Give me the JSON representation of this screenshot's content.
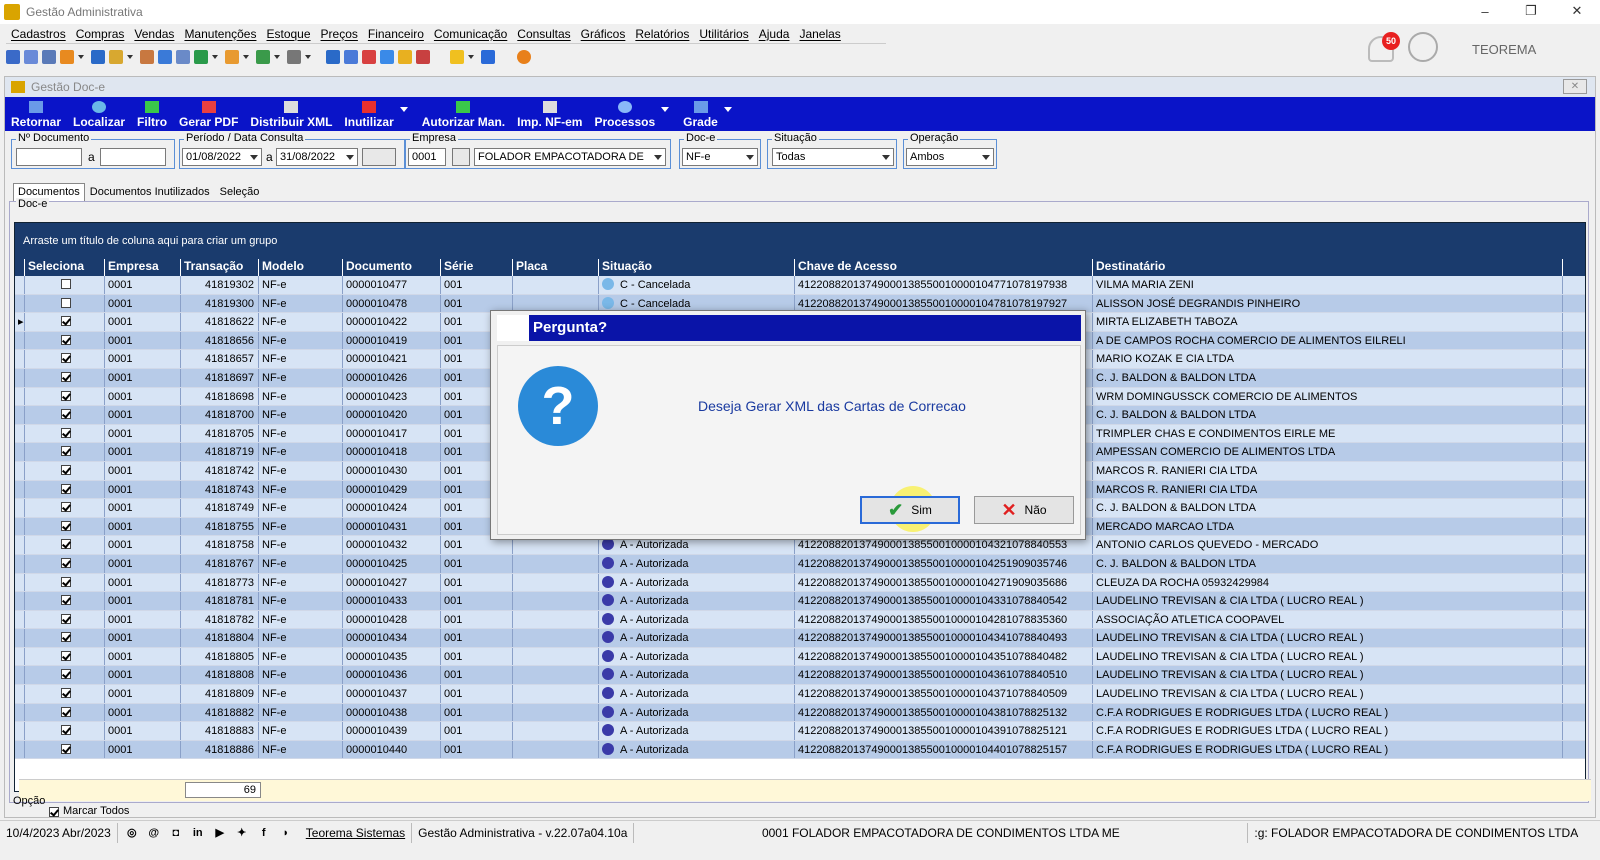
{
  "window": {
    "title": "Gestão Administrativa",
    "minimize": "–",
    "restore": "❐",
    "close": "✕"
  },
  "menu": [
    "Cadastros",
    "Compras",
    "Vendas",
    "Manutenções",
    "Estoque",
    "Preços",
    "Financeiro",
    "Comunicação",
    "Consultas",
    "Gráficos",
    "Relatórios",
    "Utilitários",
    "Ajuda",
    "Janelas"
  ],
  "topright": {
    "notifications": "50",
    "user": "TEOREMA"
  },
  "child": {
    "title": "Gestão Doc-e",
    "close": "✕"
  },
  "toolbar": [
    "Retornar",
    "Localizar",
    "Filtro",
    "Gerar PDF",
    "Distribuir XML",
    "Inutilizar",
    "Autorizar Man.",
    "Imp. NF-em",
    "Processos",
    "Grade"
  ],
  "filters": {
    "documento_label": "Nº Documento",
    "documento_from": "",
    "documento_sep": "a",
    "documento_to": "",
    "periodo_label": "Período / Data Consulta",
    "periodo_from": "01/08/2022",
    "periodo_sep": "a",
    "periodo_to": "31/08/2022",
    "empresa_label": "Empresa",
    "empresa_code": "0001",
    "empresa_name": "FOLADOR EMPACOTADORA DE CONI",
    "doce_label": "Doc-e",
    "doce_value": "NF-e",
    "situacao_label": "Situação",
    "situacao_value": "Todas",
    "operacao_label": "Operação",
    "operacao_value": "Ambos"
  },
  "tabs": [
    "Documentos",
    "Documentos Inutilizados",
    "Seleção"
  ],
  "doce_label": "Doc-e",
  "grid": {
    "group_hint": "Arraste um título de coluna aqui para criar um grupo",
    "headers": [
      "Seleciona",
      "Empresa",
      "Transação",
      "Modelo",
      "Documento",
      "Série",
      "Placa",
      "Situação",
      "Chave de Acesso",
      "Destinatário"
    ],
    "rows": [
      {
        "sel": false,
        "emp": "0001",
        "tr": "41819302",
        "mod": "NF-e",
        "doc": "0000010477",
        "ser": "001",
        "sit": "C - Cancelada",
        "sitc": "#7ab8e8",
        "key": "41220882013749000138550010000104771078197938",
        "dest": "VILMA MARIA ZENI"
      },
      {
        "sel": false,
        "emp": "0001",
        "tr": "41819300",
        "mod": "NF-e",
        "doc": "0000010478",
        "ser": "001",
        "sit": "C - Cancelada",
        "sitc": "#7ab8e8",
        "key": "41220882013749000138550010000104781078197927",
        "dest": "ALISSON JOSÉ DEGRANDIS PINHEIRO"
      },
      {
        "sel": true,
        "emp": "0001",
        "tr": "41818622",
        "mod": "NF-e",
        "doc": "0000010422",
        "ser": "001",
        "sit": "",
        "sitc": "",
        "key": "",
        "dest": "MIRTA ELIZABETH TABOZA"
      },
      {
        "sel": true,
        "emp": "0001",
        "tr": "41818656",
        "mod": "NF-e",
        "doc": "0000010419",
        "ser": "001",
        "sit": "",
        "sitc": "",
        "key": "",
        "dest": "A DE CAMPOS ROCHA COMERCIO DE ALIMENTOS EILRELI"
      },
      {
        "sel": true,
        "emp": "0001",
        "tr": "41818657",
        "mod": "NF-e",
        "doc": "0000010421",
        "ser": "001",
        "sit": "",
        "sitc": "",
        "key": "",
        "dest": "MARIO KOZAK E CIA LTDA"
      },
      {
        "sel": true,
        "emp": "0001",
        "tr": "41818697",
        "mod": "NF-e",
        "doc": "0000010426",
        "ser": "001",
        "sit": "",
        "sitc": "",
        "key": "",
        "dest": "C. J. BALDON & BALDON LTDA"
      },
      {
        "sel": true,
        "emp": "0001",
        "tr": "41818698",
        "mod": "NF-e",
        "doc": "0000010423",
        "ser": "001",
        "sit": "",
        "sitc": "",
        "key": "",
        "dest": "WRM DOMINGUSSCK COMERCIO DE ALIMENTOS"
      },
      {
        "sel": true,
        "emp": "0001",
        "tr": "41818700",
        "mod": "NF-e",
        "doc": "0000010420",
        "ser": "001",
        "sit": "",
        "sitc": "",
        "key": "",
        "dest": "C. J. BALDON & BALDON LTDA"
      },
      {
        "sel": true,
        "emp": "0001",
        "tr": "41818705",
        "mod": "NF-e",
        "doc": "0000010417",
        "ser": "001",
        "sit": "",
        "sitc": "",
        "key": "",
        "dest": "TRIMPLER CHAS E CONDIMENTOS EIRLE ME"
      },
      {
        "sel": true,
        "emp": "0001",
        "tr": "41818719",
        "mod": "NF-e",
        "doc": "0000010418",
        "ser": "001",
        "sit": "",
        "sitc": "",
        "key": "",
        "dest": "AMPESSAN COMERCIO DE ALIMENTOS LTDA"
      },
      {
        "sel": true,
        "emp": "0001",
        "tr": "41818742",
        "mod": "NF-e",
        "doc": "0000010430",
        "ser": "001",
        "sit": "",
        "sitc": "",
        "key": "",
        "dest": "MARCOS R. RANIERI CIA LTDA"
      },
      {
        "sel": true,
        "emp": "0001",
        "tr": "41818743",
        "mod": "NF-e",
        "doc": "0000010429",
        "ser": "001",
        "sit": "",
        "sitc": "",
        "key": "",
        "dest": "MARCOS R. RANIERI CIA LTDA"
      },
      {
        "sel": true,
        "emp": "0001",
        "tr": "41818749",
        "mod": "NF-e",
        "doc": "0000010424",
        "ser": "001",
        "sit": "",
        "sitc": "",
        "key": "",
        "dest": "C. J. BALDON & BALDON LTDA"
      },
      {
        "sel": true,
        "emp": "0001",
        "tr": "41818755",
        "mod": "NF-e",
        "doc": "0000010431",
        "ser": "001",
        "sit": "",
        "sitc": "",
        "key": "",
        "dest": "MERCADO MARCAO LTDA"
      },
      {
        "sel": true,
        "emp": "0001",
        "tr": "41818758",
        "mod": "NF-e",
        "doc": "0000010432",
        "ser": "001",
        "sit": "A - Autorizada",
        "sitc": "#3a3aa8",
        "key": "41220882013749000138550010000104321078840553",
        "dest": "ANTONIO CARLOS QUEVEDO - MERCADO"
      },
      {
        "sel": true,
        "emp": "0001",
        "tr": "41818767",
        "mod": "NF-e",
        "doc": "0000010425",
        "ser": "001",
        "sit": "A - Autorizada",
        "sitc": "#3a3aa8",
        "key": "41220882013749000138550010000104251909035746",
        "dest": "C. J. BALDON & BALDON LTDA"
      },
      {
        "sel": true,
        "emp": "0001",
        "tr": "41818773",
        "mod": "NF-e",
        "doc": "0000010427",
        "ser": "001",
        "sit": "A - Autorizada",
        "sitc": "#3a3aa8",
        "key": "41220882013749000138550010000104271909035686",
        "dest": "CLEUZA DA ROCHA 05932429984"
      },
      {
        "sel": true,
        "emp": "0001",
        "tr": "41818781",
        "mod": "NF-e",
        "doc": "0000010433",
        "ser": "001",
        "sit": "A - Autorizada",
        "sitc": "#3a3aa8",
        "key": "41220882013749000138550010000104331078840542",
        "dest": "LAUDELINO TREVISAN & CIA LTDA ( LUCRO REAL )"
      },
      {
        "sel": true,
        "emp": "0001",
        "tr": "41818782",
        "mod": "NF-e",
        "doc": "0000010428",
        "ser": "001",
        "sit": "A - Autorizada",
        "sitc": "#3a3aa8",
        "key": "41220882013749000138550010000104281078835360",
        "dest": "ASSOCIAÇÃO ATLETICA COOPAVEL"
      },
      {
        "sel": true,
        "emp": "0001",
        "tr": "41818804",
        "mod": "NF-e",
        "doc": "0000010434",
        "ser": "001",
        "sit": "A - Autorizada",
        "sitc": "#3a3aa8",
        "key": "41220882013749000138550010000104341078840493",
        "dest": "LAUDELINO TREVISAN & CIA LTDA ( LUCRO REAL )"
      },
      {
        "sel": true,
        "emp": "0001",
        "tr": "41818805",
        "mod": "NF-e",
        "doc": "0000010435",
        "ser": "001",
        "sit": "A - Autorizada",
        "sitc": "#3a3aa8",
        "key": "41220882013749000138550010000104351078840482",
        "dest": "LAUDELINO TREVISAN & CIA LTDA ( LUCRO REAL )"
      },
      {
        "sel": true,
        "emp": "0001",
        "tr": "41818808",
        "mod": "NF-e",
        "doc": "0000010436",
        "ser": "001",
        "sit": "A - Autorizada",
        "sitc": "#3a3aa8",
        "key": "41220882013749000138550010000104361078840510",
        "dest": "LAUDELINO TREVISAN & CIA LTDA ( LUCRO REAL )"
      },
      {
        "sel": true,
        "emp": "0001",
        "tr": "41818809",
        "mod": "NF-e",
        "doc": "0000010437",
        "ser": "001",
        "sit": "A - Autorizada",
        "sitc": "#3a3aa8",
        "key": "41220882013749000138550010000104371078840509",
        "dest": "LAUDELINO TREVISAN & CIA LTDA ( LUCRO REAL )"
      },
      {
        "sel": true,
        "emp": "0001",
        "tr": "41818882",
        "mod": "NF-e",
        "doc": "0000010438",
        "ser": "001",
        "sit": "A - Autorizada",
        "sitc": "#3a3aa8",
        "key": "41220882013749000138550010000104381078825132",
        "dest": "C.F.A RODRIGUES E RODRIGUES LTDA ( LUCRO REAL )"
      },
      {
        "sel": true,
        "emp": "0001",
        "tr": "41818883",
        "mod": "NF-e",
        "doc": "0000010439",
        "ser": "001",
        "sit": "A - Autorizada",
        "sitc": "#3a3aa8",
        "key": "41220882013749000138550010000104391078825121",
        "dest": "C.F.A RODRIGUES E RODRIGUES LTDA ( LUCRO REAL )"
      },
      {
        "sel": true,
        "emp": "0001",
        "tr": "41818886",
        "mod": "NF-e",
        "doc": "0000010440",
        "ser": "001",
        "sit": "A - Autorizada",
        "sitc": "#3a3aa8",
        "key": "41220882013749000138550010000104401078825157",
        "dest": "C.F.A RODRIGUES E RODRIGUES LTDA ( LUCRO REAL )"
      }
    ],
    "count": "69"
  },
  "opcao": {
    "label": "Opção",
    "marcar_todos": "Marcar Todos",
    "checked": true
  },
  "status": {
    "date": "10/4/2023 Abr/2023",
    "brand": "Teorema Sistemas",
    "version": "Gestão Administrativa - v.22.07a04.10a",
    "company": "0001 FOLADOR EMPACOTADORA DE CONDIMENTOS LTDA ME",
    "right": ":g: FOLADOR EMPACOTADORA DE CONDIMENTOS LTDA"
  },
  "dialog": {
    "title": "Pergunta?",
    "message": "Deseja Gerar XML das Cartas de Correcao",
    "yes": "Sim",
    "no": "Não"
  }
}
